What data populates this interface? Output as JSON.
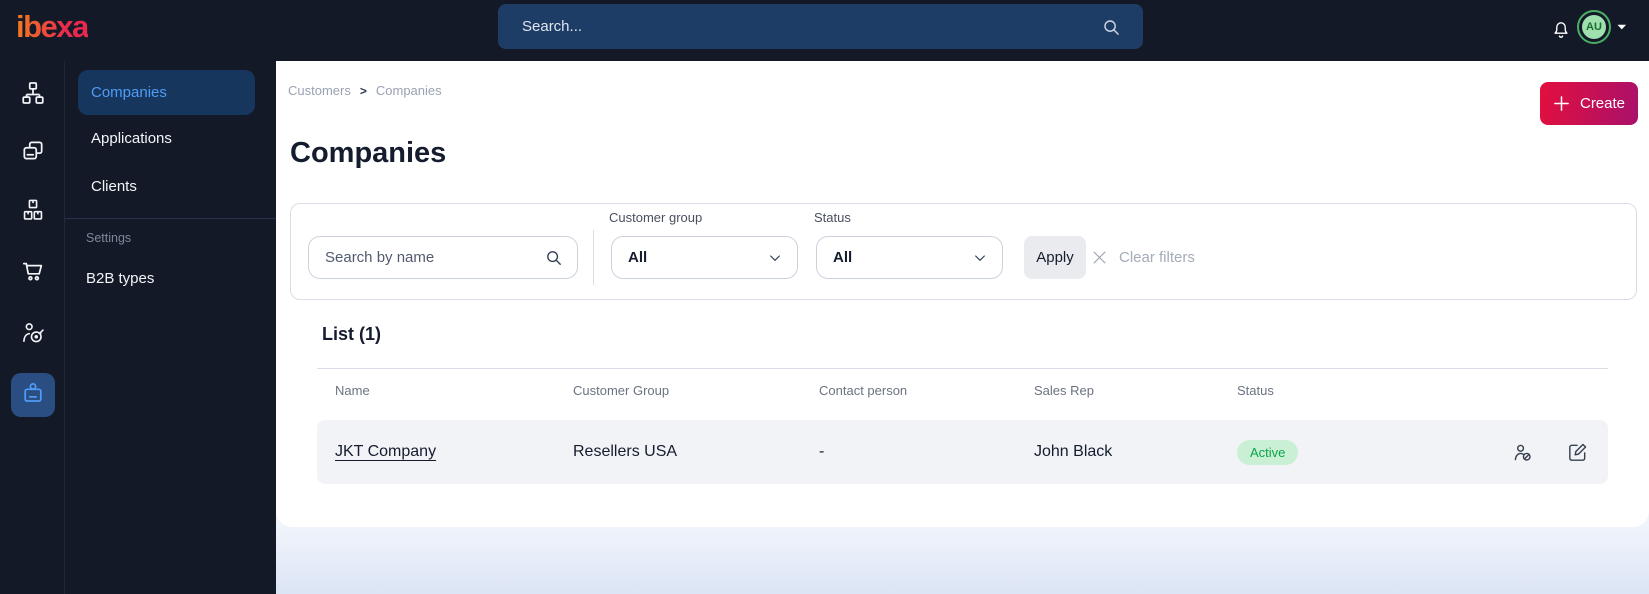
{
  "topbar": {
    "logo": "ibexa",
    "search": {
      "placeholder": "Search...",
      "icon": "search-icon"
    },
    "notifications_icon": "bell-icon",
    "user": {
      "initials": "AU",
      "menu_icon": "caret-down-icon"
    }
  },
  "nav_rail": {
    "items": [
      {
        "icon": "sitemap-icon",
        "active": false
      },
      {
        "icon": "pages-icon",
        "active": false
      },
      {
        "icon": "products-boxes-icon",
        "active": false
      },
      {
        "icon": "cart-icon",
        "active": false
      },
      {
        "icon": "personalization-target-icon",
        "active": false
      },
      {
        "icon": "customer-badge-icon",
        "active": true
      }
    ]
  },
  "sidebar": {
    "menu": [
      {
        "label": "Companies",
        "active": true
      },
      {
        "label": "Applications",
        "active": false
      },
      {
        "label": "Clients",
        "active": false
      }
    ],
    "section": {
      "label": "Settings",
      "items": [
        {
          "label": "B2B types"
        }
      ]
    }
  },
  "breadcrumb": {
    "items": [
      "Customers",
      "Companies"
    ],
    "separator": ">"
  },
  "page": {
    "title": "Companies"
  },
  "actions": {
    "create_label": "Create",
    "create_icon": "plus-icon"
  },
  "filters": {
    "search_placeholder": "Search by name",
    "customer_group": {
      "label": "Customer group",
      "value": "All"
    },
    "status": {
      "label": "Status",
      "value": "All"
    },
    "apply_label": "Apply",
    "clear_label": "Clear filters"
  },
  "list": {
    "title": "List (1)",
    "columns": [
      "Name",
      "Customer Group",
      "Contact person",
      "Sales Rep",
      "Status"
    ],
    "rows": [
      {
        "name": "JKT Company",
        "customer_group": "Resellers USA",
        "contact_person": "-",
        "sales_rep": "John Black",
        "status": "Active",
        "actions": [
          "deactivate-user-icon",
          "edit-icon"
        ]
      }
    ]
  },
  "colors": {
    "accent_blue": "#4e9cf5",
    "badge_bg": "#c9f0d4",
    "badge_text": "#0fa24b",
    "create_a": "#e30f3d",
    "create_b": "#a9116b",
    "logo_a": "#f47b20",
    "logo_b": "#e82a4e"
  }
}
